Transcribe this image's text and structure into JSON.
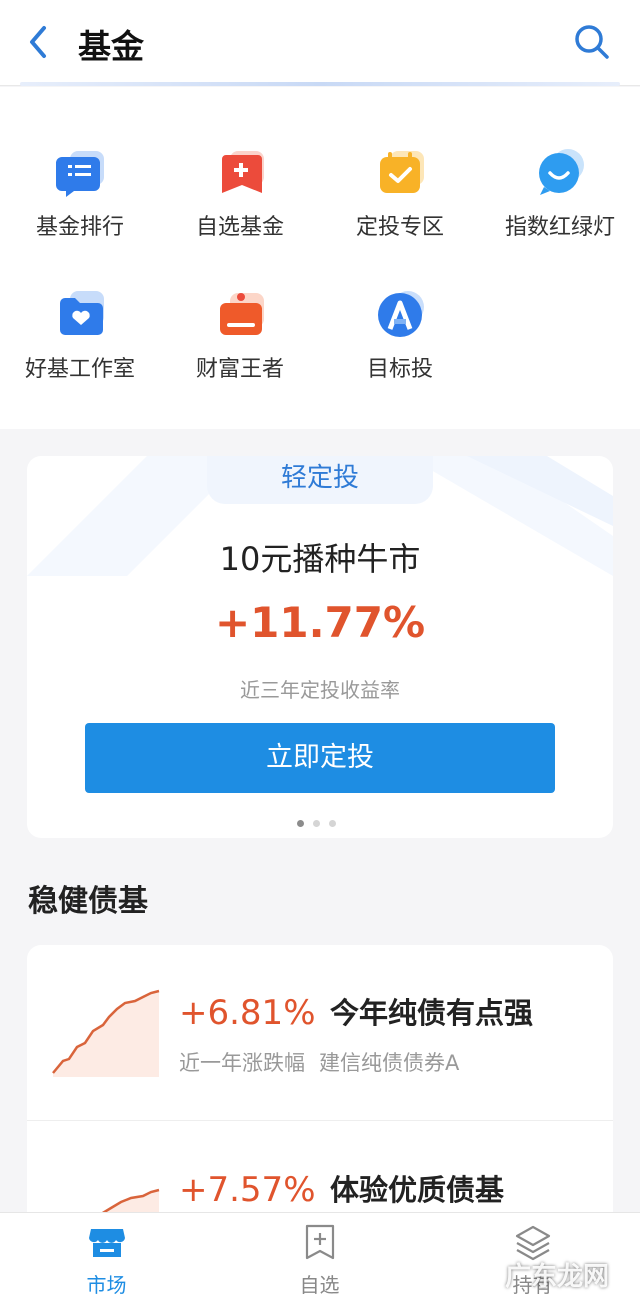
{
  "header": {
    "title": "基金",
    "back_icon": "chevron-left-icon",
    "search_icon": "search-icon",
    "accent_color": "#2f7bd6"
  },
  "shortcuts": [
    {
      "label": "基金排行",
      "icon": "list-icon"
    },
    {
      "label": "自选基金",
      "icon": "add-bookmark-icon"
    },
    {
      "label": "定投专区",
      "icon": "calendar-check-icon"
    },
    {
      "label": "指数红绿灯",
      "icon": "chat-smile-icon"
    },
    {
      "label": "好基工作室",
      "icon": "folder-heart-icon"
    },
    {
      "label": "财富王者",
      "icon": "crown-icon"
    },
    {
      "label": "目标投",
      "icon": "target-a-icon"
    }
  ],
  "promo": {
    "tab": "轻定投",
    "title": "10元播种牛市",
    "rate": "+11.77%",
    "subtitle": "近三年定投收益率",
    "button": "立即定投",
    "page_count": 3,
    "active_page": 1
  },
  "section": {
    "title": "稳健债基"
  },
  "funds": [
    {
      "rate": "+6.81%",
      "name": "今年纯债有点强",
      "period": "近一年涨跌幅",
      "fund": "建信纯债债券A"
    },
    {
      "rate": "+7.57%",
      "name": "体验优质债基",
      "period": "",
      "fund": ""
    }
  ],
  "nav": {
    "items": [
      {
        "label": "市场",
        "icon": "market-store-icon",
        "active": true
      },
      {
        "label": "自选",
        "icon": "bookmark-plus-icon",
        "active": false
      },
      {
        "label": "持有",
        "icon": "layers-icon",
        "active": false
      }
    ]
  },
  "watermark": "广东龙网",
  "colors": {
    "primary": "#1e8de3",
    "gain": "#e0542d"
  }
}
